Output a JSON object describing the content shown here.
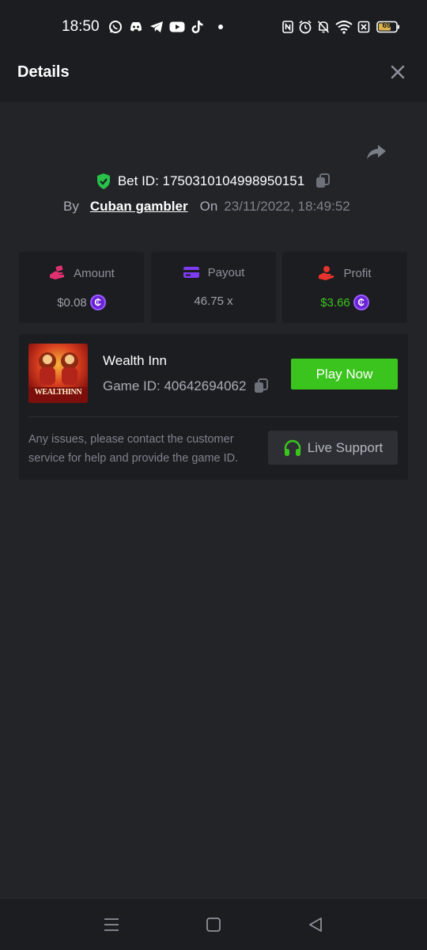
{
  "status_bar": {
    "time": "18:50",
    "app_icons": [
      "whatsapp-icon",
      "discord-icon",
      "telegram-icon",
      "youtube-icon",
      "tiktok-icon",
      "dot-icon"
    ],
    "right_icons": [
      "nfc-icon",
      "alarm-icon",
      "bell-muted-icon",
      "wifi-icon",
      "sim-off-icon",
      "battery-icon"
    ],
    "battery": "69"
  },
  "header": {
    "title": "Details",
    "close_icon": "close-icon"
  },
  "bet": {
    "bet_id_label": "Bet ID: 1750310104998950151",
    "by_label": "By",
    "username": "Cuban gambler",
    "on_label": "On",
    "datetime": "23/11/2022, 18:49:52",
    "icons": [
      "shield-check-icon",
      "copy-icon",
      "share-icon"
    ]
  },
  "stats": [
    {
      "label": "Amount",
      "value": "$0.08",
      "icon": "bet-hand-icon",
      "coin": true,
      "color": "#9ea2aa"
    },
    {
      "label": "Payout",
      "value": "46.75 x",
      "icon": "card-icon",
      "coin": false,
      "color": "#9ea2aa"
    },
    {
      "label": "Profit",
      "value": "$3.66",
      "icon": "profit-hand-icon",
      "coin": true,
      "color": "#3cc41e"
    }
  ],
  "game": {
    "name": "Wealth Inn",
    "thumbnail_text": "WEALTHINN",
    "game_id_label": "Game ID: 40642694062",
    "play_label": "Play Now",
    "issues_text": "Any issues, please contact the customer service for help and provide the game ID.",
    "support_label": "Live Support",
    "support_icon": "headset-icon"
  },
  "coin_symbol": "₵",
  "colors": {
    "accent_green": "#3cc41e",
    "coin_purple": "#6a22d6",
    "amount_pink": "#e0316f",
    "payout_purple": "#7d3cf2",
    "profit_red": "#e8332d",
    "shield_green": "#27c24a"
  },
  "nav": [
    "menu-icon",
    "home-icon",
    "back-icon"
  ]
}
